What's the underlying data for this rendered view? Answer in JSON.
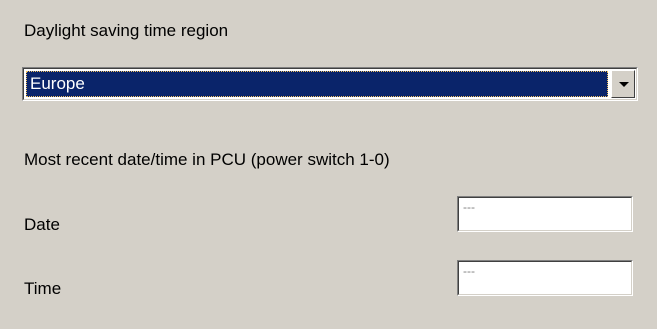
{
  "dst": {
    "label": "Daylight saving time region",
    "selected": "Europe"
  },
  "recent": {
    "label": "Most recent date/time in PCU (power switch 1-0)"
  },
  "date": {
    "label": "Date",
    "value": "---"
  },
  "time": {
    "label": "Time",
    "value": "---"
  }
}
